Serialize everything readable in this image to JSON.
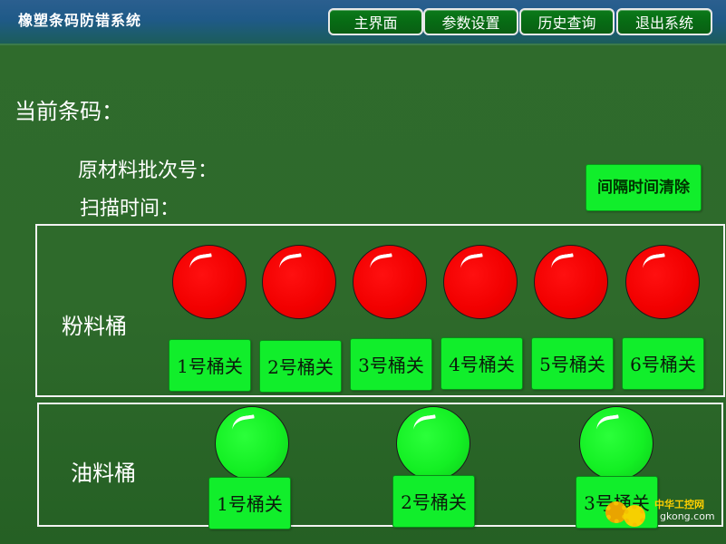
{
  "app": {
    "title": "橡塑条码防错系统"
  },
  "nav": [
    {
      "label": "主界面"
    },
    {
      "label": "参数设置"
    },
    {
      "label": "历史查询"
    },
    {
      "label": "退出系统"
    }
  ],
  "info": {
    "current_barcode_label": "当前条码：",
    "batch_label": "原材料批次号：",
    "scan_time_label": "扫描时间："
  },
  "clear_button": {
    "label": "间隔时间清除"
  },
  "powder": {
    "label": "粉料桶",
    "lamps": [
      {
        "status": "red",
        "color": "#f20000"
      },
      {
        "status": "red",
        "color": "#f20000"
      },
      {
        "status": "red",
        "color": "#f20000"
      },
      {
        "status": "red",
        "color": "#f20000"
      },
      {
        "status": "red",
        "color": "#f20000"
      },
      {
        "status": "red",
        "color": "#f20000"
      }
    ],
    "buttons": [
      {
        "label": "1号桶关"
      },
      {
        "label": "2号桶关"
      },
      {
        "label": "3号桶关"
      },
      {
        "label": "4号桶关"
      },
      {
        "label": "5号桶关"
      },
      {
        "label": "6号桶关"
      }
    ]
  },
  "oil": {
    "label": "油料桶",
    "lamps": [
      {
        "status": "green",
        "color": "#14f024"
      },
      {
        "status": "green",
        "color": "#14f024"
      },
      {
        "status": "green",
        "color": "#14f024"
      }
    ],
    "buttons": [
      {
        "label": "1号桶关"
      },
      {
        "label": "2号桶关"
      },
      {
        "label": "3号桶关"
      }
    ]
  },
  "watermark": {
    "line1": "中华工控网",
    "line2": "gkong.com"
  }
}
